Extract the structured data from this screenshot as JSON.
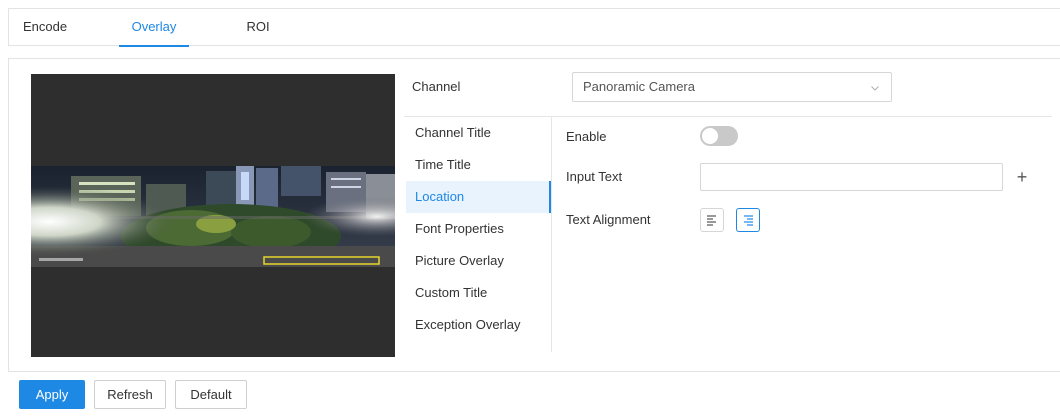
{
  "tabs": [
    {
      "label": "Encode",
      "active": false
    },
    {
      "label": "Overlay",
      "active": true
    },
    {
      "label": "ROI",
      "active": false
    }
  ],
  "channel": {
    "label": "Channel",
    "selected": "Panoramic Camera"
  },
  "overlay_menu": [
    {
      "label": "Channel Title",
      "active": false
    },
    {
      "label": "Time Title",
      "active": false
    },
    {
      "label": "Location",
      "active": true
    },
    {
      "label": "Font Properties",
      "active": false
    },
    {
      "label": "Picture Overlay",
      "active": false
    },
    {
      "label": "Custom Title",
      "active": false
    },
    {
      "label": "Exception Overlay",
      "active": false
    }
  ],
  "location_form": {
    "enable_label": "Enable",
    "enable_on": false,
    "input_text_label": "Input Text",
    "input_text_value": "",
    "text_alignment_label": "Text Alignment",
    "alignment_options": [
      {
        "icon": "align-left-icon",
        "selected": false
      },
      {
        "icon": "align-right-icon",
        "selected": true
      }
    ],
    "add_symbol": "+"
  },
  "footer": {
    "apply_label": "Apply",
    "refresh_label": "Refresh",
    "default_label": "Default"
  },
  "colors": {
    "accent": "#1e88e5",
    "video_background": "#2e2e2e",
    "overlay_box": "#e8d42a"
  },
  "icons": {
    "dropdown": "chevron-down-icon",
    "add": "plus-icon"
  }
}
